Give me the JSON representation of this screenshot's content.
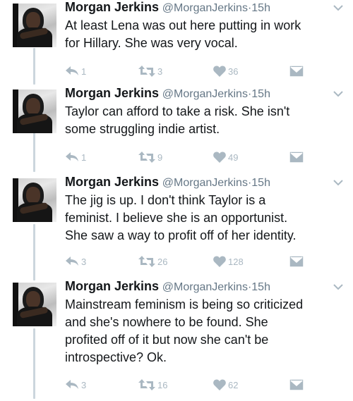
{
  "tweets": [
    {
      "name": "Morgan Jerkins",
      "handle": "@MorganJerkins",
      "separator": "·",
      "time": "15h",
      "lines": [
        "At least Lena was out here putting in work",
        "for Hillary. She was very vocal."
      ],
      "replies": "1",
      "retweets": "3",
      "likes": "36"
    },
    {
      "name": "Morgan Jerkins",
      "handle": "@MorganJerkins",
      "separator": "·",
      "time": "15h",
      "lines": [
        "Taylor can afford to take a risk. She isn't",
        "some struggling indie artist."
      ],
      "replies": "1",
      "retweets": "9",
      "likes": "49"
    },
    {
      "name": "Morgan Jerkins",
      "handle": "@MorganJerkins",
      "separator": "·",
      "time": "15h",
      "lines": [
        "The jig is up. I don't think Taylor is a",
        "feminist. I believe she is an opportunist.",
        "She saw a way to profit off of her identity."
      ],
      "replies": "3",
      "retweets": "26",
      "likes": "128"
    },
    {
      "name": "Morgan Jerkins",
      "handle": "@MorganJerkins",
      "separator": "·",
      "time": "15h",
      "lines": [
        "Mainstream feminism is being so criticized",
        "and she's nowhere to be found. She",
        "profited off of it but now she can't be",
        "introspective? Ok."
      ],
      "replies": "3",
      "retweets": "16",
      "likes": "62"
    }
  ],
  "icons": {
    "reply": "reply-icon",
    "retweet": "retweet-icon",
    "like": "heart-icon",
    "dm": "direct-message-icon",
    "more": "chevron-down-icon"
  },
  "colors": {
    "text": "#14171a",
    "muted": "#657786",
    "icon": "#aab8c2",
    "thread_line": "#ccd6dd"
  }
}
